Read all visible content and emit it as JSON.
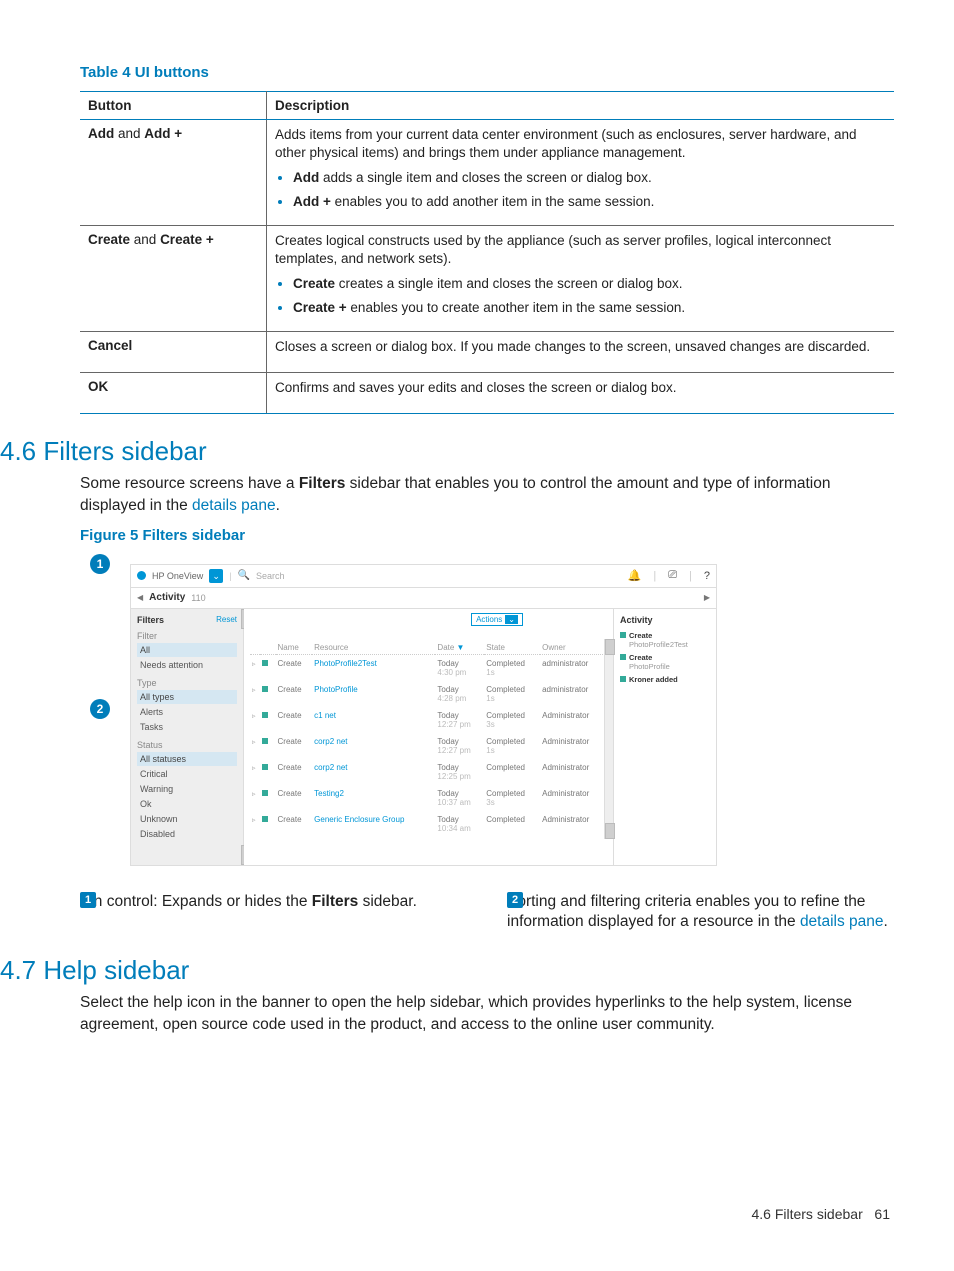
{
  "table": {
    "caption": "Table 4 UI buttons",
    "headers": [
      "Button",
      "Description"
    ],
    "rows": [
      {
        "button_html": "<b>Add</b> and <b>Add +</b>",
        "desc_lead": "Adds items from your current data center environment (such as enclosures, server hardware, and other physical items) and brings them under appliance management.",
        "bullets": [
          "<b>Add</b> adds a single item and closes the screen or dialog box.",
          "<b>Add +</b> enables you to add another item in the same session."
        ]
      },
      {
        "button_html": "<b>Create</b> and <b>Create +</b>",
        "desc_lead": "Creates logical constructs used by the appliance (such as server profiles, logical interconnect templates, and network sets).",
        "bullets": [
          "<b>Create</b> creates a single item and closes the screen or dialog box.",
          "<b>Create +</b> enables you to create another item in the same session."
        ]
      },
      {
        "button_html": "<b>Cancel</b>",
        "desc_lead": "Closes a screen or dialog box. If you made changes to the screen, unsaved changes are discarded.",
        "bullets": []
      },
      {
        "button_html": "<b>OK</b>",
        "desc_lead": "Confirms and saves your edits and closes the screen or dialog box.",
        "bullets": []
      }
    ]
  },
  "section46": {
    "heading": "4.6 Filters sidebar",
    "para_before": "Some resource screens have a ",
    "para_bold": "Filters",
    "para_after": " sidebar that enables you to control the amount and type of information displayed in the ",
    "para_link": "details pane",
    "para_end": ".",
    "figure_caption": "Figure 5 Filters sidebar"
  },
  "shot": {
    "app": "HP OneView",
    "search_ph": "Search",
    "crumb": "Activity",
    "crumb_count": "110",
    "actions": "Actions",
    "filters_title": "Filters",
    "reset": "Reset",
    "filter_label": "Filter",
    "filter_opts": [
      "All",
      "Needs attention"
    ],
    "type_label": "Type",
    "type_opts": [
      "All types",
      "Alerts",
      "Tasks"
    ],
    "status_label": "Status",
    "status_opts": [
      "All statuses",
      "Critical",
      "Warning",
      "Ok",
      "Unknown",
      "Disabled"
    ],
    "grid_headers": [
      "",
      "",
      "Name",
      "Resource",
      "Date",
      "State",
      "Owner"
    ],
    "grid_rows": [
      {
        "name": "Create",
        "res": "PhotoProfile2Test",
        "date": "Today",
        "time": "4:30 pm",
        "state": "Completed",
        "dur": "1s",
        "owner": "administrator"
      },
      {
        "name": "Create",
        "res": "PhotoProfile",
        "date": "Today",
        "time": "4:28 pm",
        "state": "Completed",
        "dur": "1s",
        "owner": "administrator"
      },
      {
        "name": "Create",
        "res": "c1 net",
        "date": "Today",
        "time": "12:27 pm",
        "state": "Completed",
        "dur": "3s",
        "owner": "Administrator"
      },
      {
        "name": "Create",
        "res": "corp2 net",
        "date": "Today",
        "time": "12:27 pm",
        "state": "Completed",
        "dur": "1s",
        "owner": "Administrator"
      },
      {
        "name": "Create",
        "res": "corp2 net",
        "date": "Today",
        "time": "12:25 pm",
        "state": "Completed",
        "dur": "",
        "owner": "Administrator"
      },
      {
        "name": "Create",
        "res": "Testing2",
        "date": "Today",
        "time": "10:37 am",
        "state": "Completed",
        "dur": "3s",
        "owner": "Administrator"
      },
      {
        "name": "Create",
        "res": "Generic Enclosure Group",
        "date": "Today",
        "time": "10:34 am",
        "state": "Completed",
        "dur": "",
        "owner": "Administrator"
      }
    ],
    "side_title": "Activity",
    "side_items": [
      {
        "b": "Create",
        "sub": "PhotoProfile2Test"
      },
      {
        "b": "Create",
        "sub": "PhotoProfile"
      },
      {
        "b": "Kroner added",
        "sub": ""
      }
    ]
  },
  "legend": {
    "1": {
      "pre": "Pin control: Expands or hides the ",
      "b": "Filters",
      "post": " sidebar."
    },
    "2": {
      "pre": "Sorting and filtering criteria enables you to refine the information displayed for a resource in the ",
      "link": "details pane",
      "post": "."
    }
  },
  "section47": {
    "heading": "4.7 Help sidebar",
    "para": "Select the help icon in the banner to open the help sidebar, which provides hyperlinks to the help system, license agreement, open source code used in the product, and access to the online user community."
  },
  "footer": {
    "title": "4.6 Filters sidebar",
    "page": "61"
  }
}
